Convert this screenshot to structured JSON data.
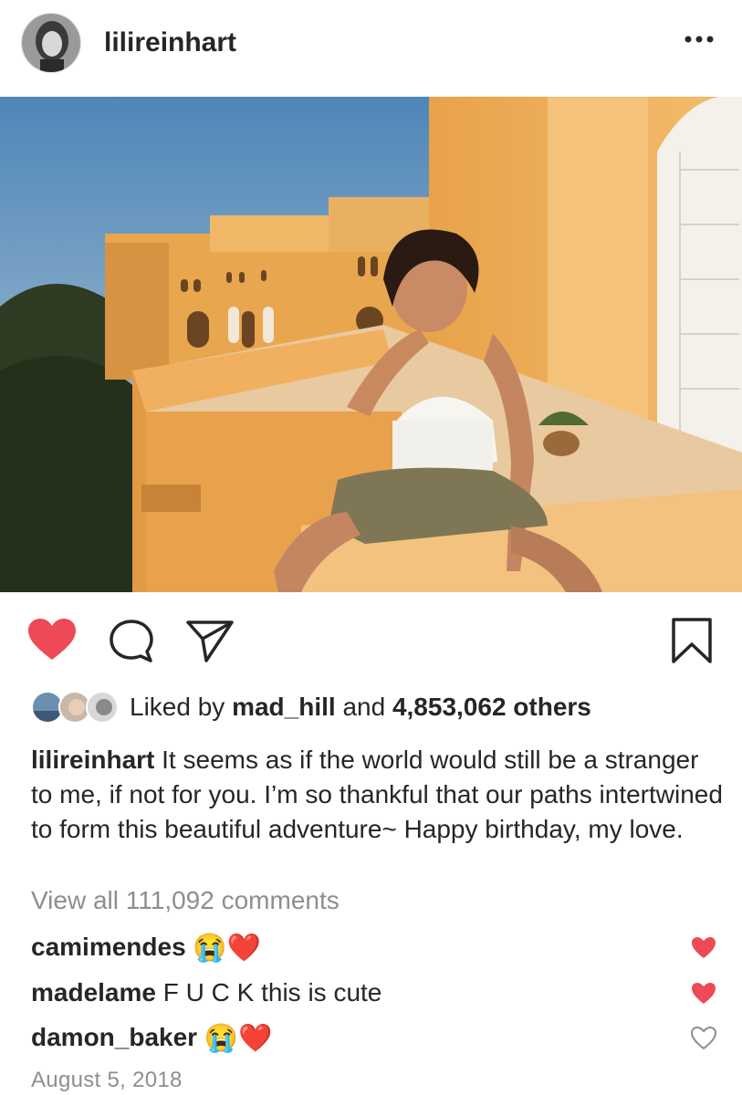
{
  "post": {
    "username": "lilireinhart",
    "likes": {
      "prefix": "Liked by",
      "first_liker": "mad_hill",
      "joiner": "and",
      "others": "4,853,062 others"
    },
    "caption": {
      "username": "lilireinhart",
      "text": "It seems as if the world would still be a stranger to me, if not for you. I’m so thankful that our paths intertwined to form this beautiful adventure~ Happy birthday, my love."
    },
    "view_all_comments": "View all 111,092 comments",
    "comments": [
      {
        "username": "camimendes",
        "text": "",
        "emojis": "😭❤️",
        "liked": true
      },
      {
        "username": "madelame",
        "text": "F U C K this is cute",
        "emojis": "",
        "liked": true
      },
      {
        "username": "damon_baker",
        "text": "",
        "emojis": "😭❤️",
        "liked": false
      }
    ],
    "date": "August 5, 2018"
  },
  "icons": {
    "like": "heart-icon",
    "comment": "comment-bubble-icon",
    "share": "paper-plane-icon",
    "save": "bookmark-icon",
    "more": "more-dots-icon"
  },
  "colors": {
    "liked_heart": "#ed4956",
    "secondary_text": "#8e8e8e"
  }
}
